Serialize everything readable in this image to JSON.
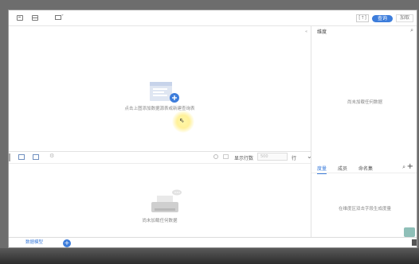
{
  "toolbar": {
    "bracket_label": "[↑]",
    "pill_label": "查询",
    "add_label": "加取"
  },
  "left_top": {
    "collapse_mark": "«",
    "empty_text": "点击上图添加数据源表或新建查询表"
  },
  "right_top": {
    "title": "维度",
    "empty_text": "尚未加载任何数据"
  },
  "left_bottom": {
    "show_rows_label": "显示行数",
    "rows_placeholder": "500",
    "rows_unit": "行",
    "empty_text": "尚未加载任何数据"
  },
  "right_bottom": {
    "tabs": [
      "度量",
      "成员",
      "命名集"
    ],
    "empty_text": "在维度区双击字段生成度量"
  },
  "bottom": {
    "sheet_label": "数据模型"
  },
  "colors": {
    "accent": "#3d7ddb"
  }
}
